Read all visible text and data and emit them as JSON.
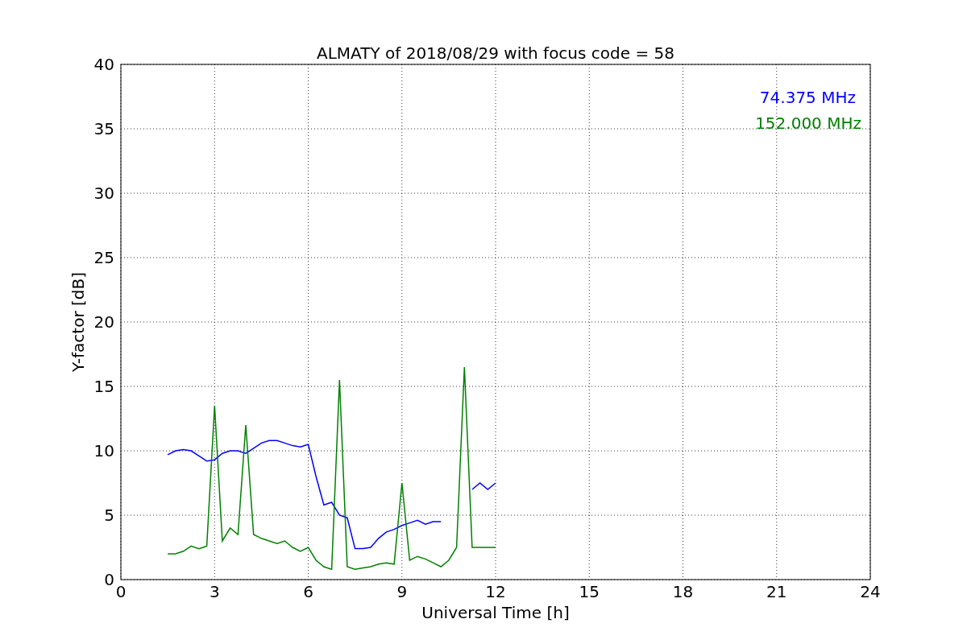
{
  "chart_data": {
    "type": "line",
    "title": "ALMATY of 2018/08/29 with focus code = 58",
    "xlabel": "Universal Time [h]",
    "ylabel": "Y-factor [dB]",
    "x": [
      1.5,
      1.75,
      2,
      2.25,
      2.5,
      2.75,
      3,
      3.25,
      3.5,
      3.75,
      4,
      4.25,
      4.5,
      4.75,
      5,
      5.25,
      5.5,
      5.75,
      6,
      6.25,
      6.5,
      6.75,
      7,
      7.25,
      7.5,
      7.75,
      8,
      8.25,
      8.5,
      8.75,
      9,
      9.25,
      9.5,
      9.75,
      10,
      10.25,
      10.5,
      10.75,
      11,
      11.25,
      11.5,
      11.75,
      12
    ],
    "series": [
      {
        "name": "74.375 MHz",
        "color": "#0000ff",
        "values": [
          9.7,
          10,
          10.1,
          10,
          9.6,
          9.2,
          9.3,
          9.8,
          10,
          10,
          9.8,
          10.2,
          10.6,
          10.8,
          10.8,
          10.6,
          10.4,
          10.3,
          10.5,
          8,
          5.8,
          6,
          5,
          4.8,
          2.4,
          2.4,
          2.5,
          3.2,
          3.7,
          3.9,
          4.2,
          4.4,
          4.6,
          4.3,
          4.5,
          4.5,
          null,
          null,
          null,
          7,
          7.5,
          7,
          7.5
        ]
      },
      {
        "name": "152.000 MHz",
        "color": "#008000",
        "values": [
          2,
          2,
          2.2,
          2.6,
          2.4,
          2.6,
          13.5,
          3,
          4,
          3.5,
          12,
          3.5,
          3.2,
          3,
          2.8,
          3,
          2.5,
          2.2,
          2.5,
          1.5,
          1,
          0.8,
          15.5,
          1,
          0.8,
          0.9,
          1,
          1.2,
          1.3,
          1.2,
          7.5,
          1.5,
          1.8,
          1.6,
          1.3,
          1,
          1.5,
          2.5,
          16.5,
          2.5,
          2.5,
          2.5,
          2.5
        ]
      }
    ],
    "xlim": [
      0,
      24
    ],
    "ylim": [
      0,
      40
    ],
    "xticks": [
      0,
      3,
      6,
      9,
      12,
      15,
      18,
      21,
      24
    ],
    "yticks": [
      0,
      5,
      10,
      15,
      20,
      25,
      30,
      35,
      40
    ],
    "grid": true
  }
}
